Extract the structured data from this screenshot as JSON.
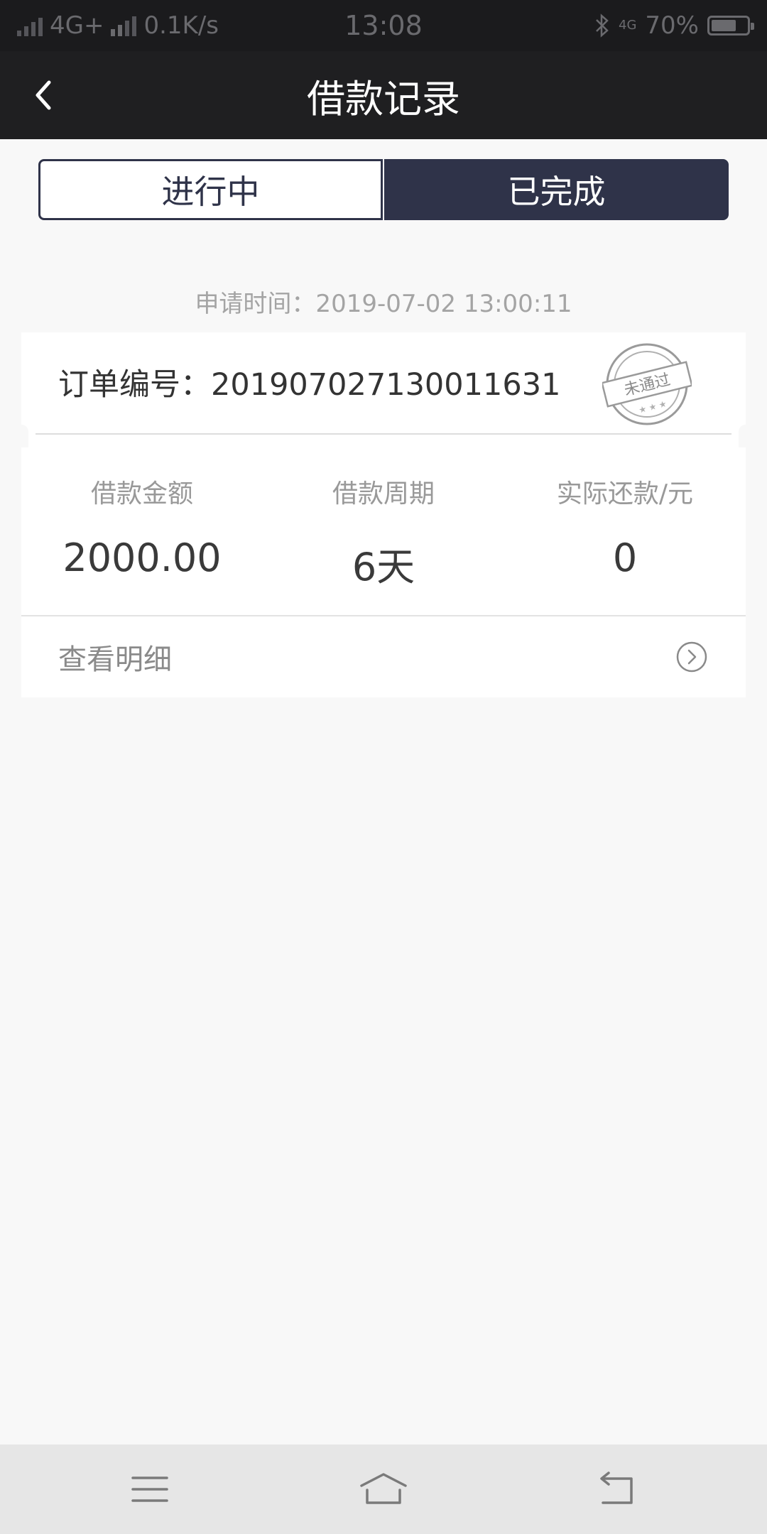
{
  "status_bar": {
    "network": "4G+",
    "speed": "0.1K/s",
    "time": "13:08",
    "net_badge": "4G",
    "battery": "70%",
    "battery_level": 0.7
  },
  "nav": {
    "title": "借款记录"
  },
  "tabs": [
    {
      "label": "进行中",
      "active": false
    },
    {
      "label": "已完成",
      "active": true
    }
  ],
  "record": {
    "apply_time": "申请时间：2019-07-02 13:00:11",
    "order_no": "订单编号：201907027130011631",
    "stamp_text": "未通过",
    "stats": [
      {
        "label": "借款金额",
        "value": "2000.00"
      },
      {
        "label": "借款周期",
        "value": "6天"
      },
      {
        "label": "实际还款/元",
        "value": "0"
      }
    ],
    "detail_label": "查看明细"
  },
  "colors": {
    "tab_active_bg": "#2f3349",
    "nav_bg": "#1f1f21",
    "page_bg": "#f8f8f8"
  }
}
